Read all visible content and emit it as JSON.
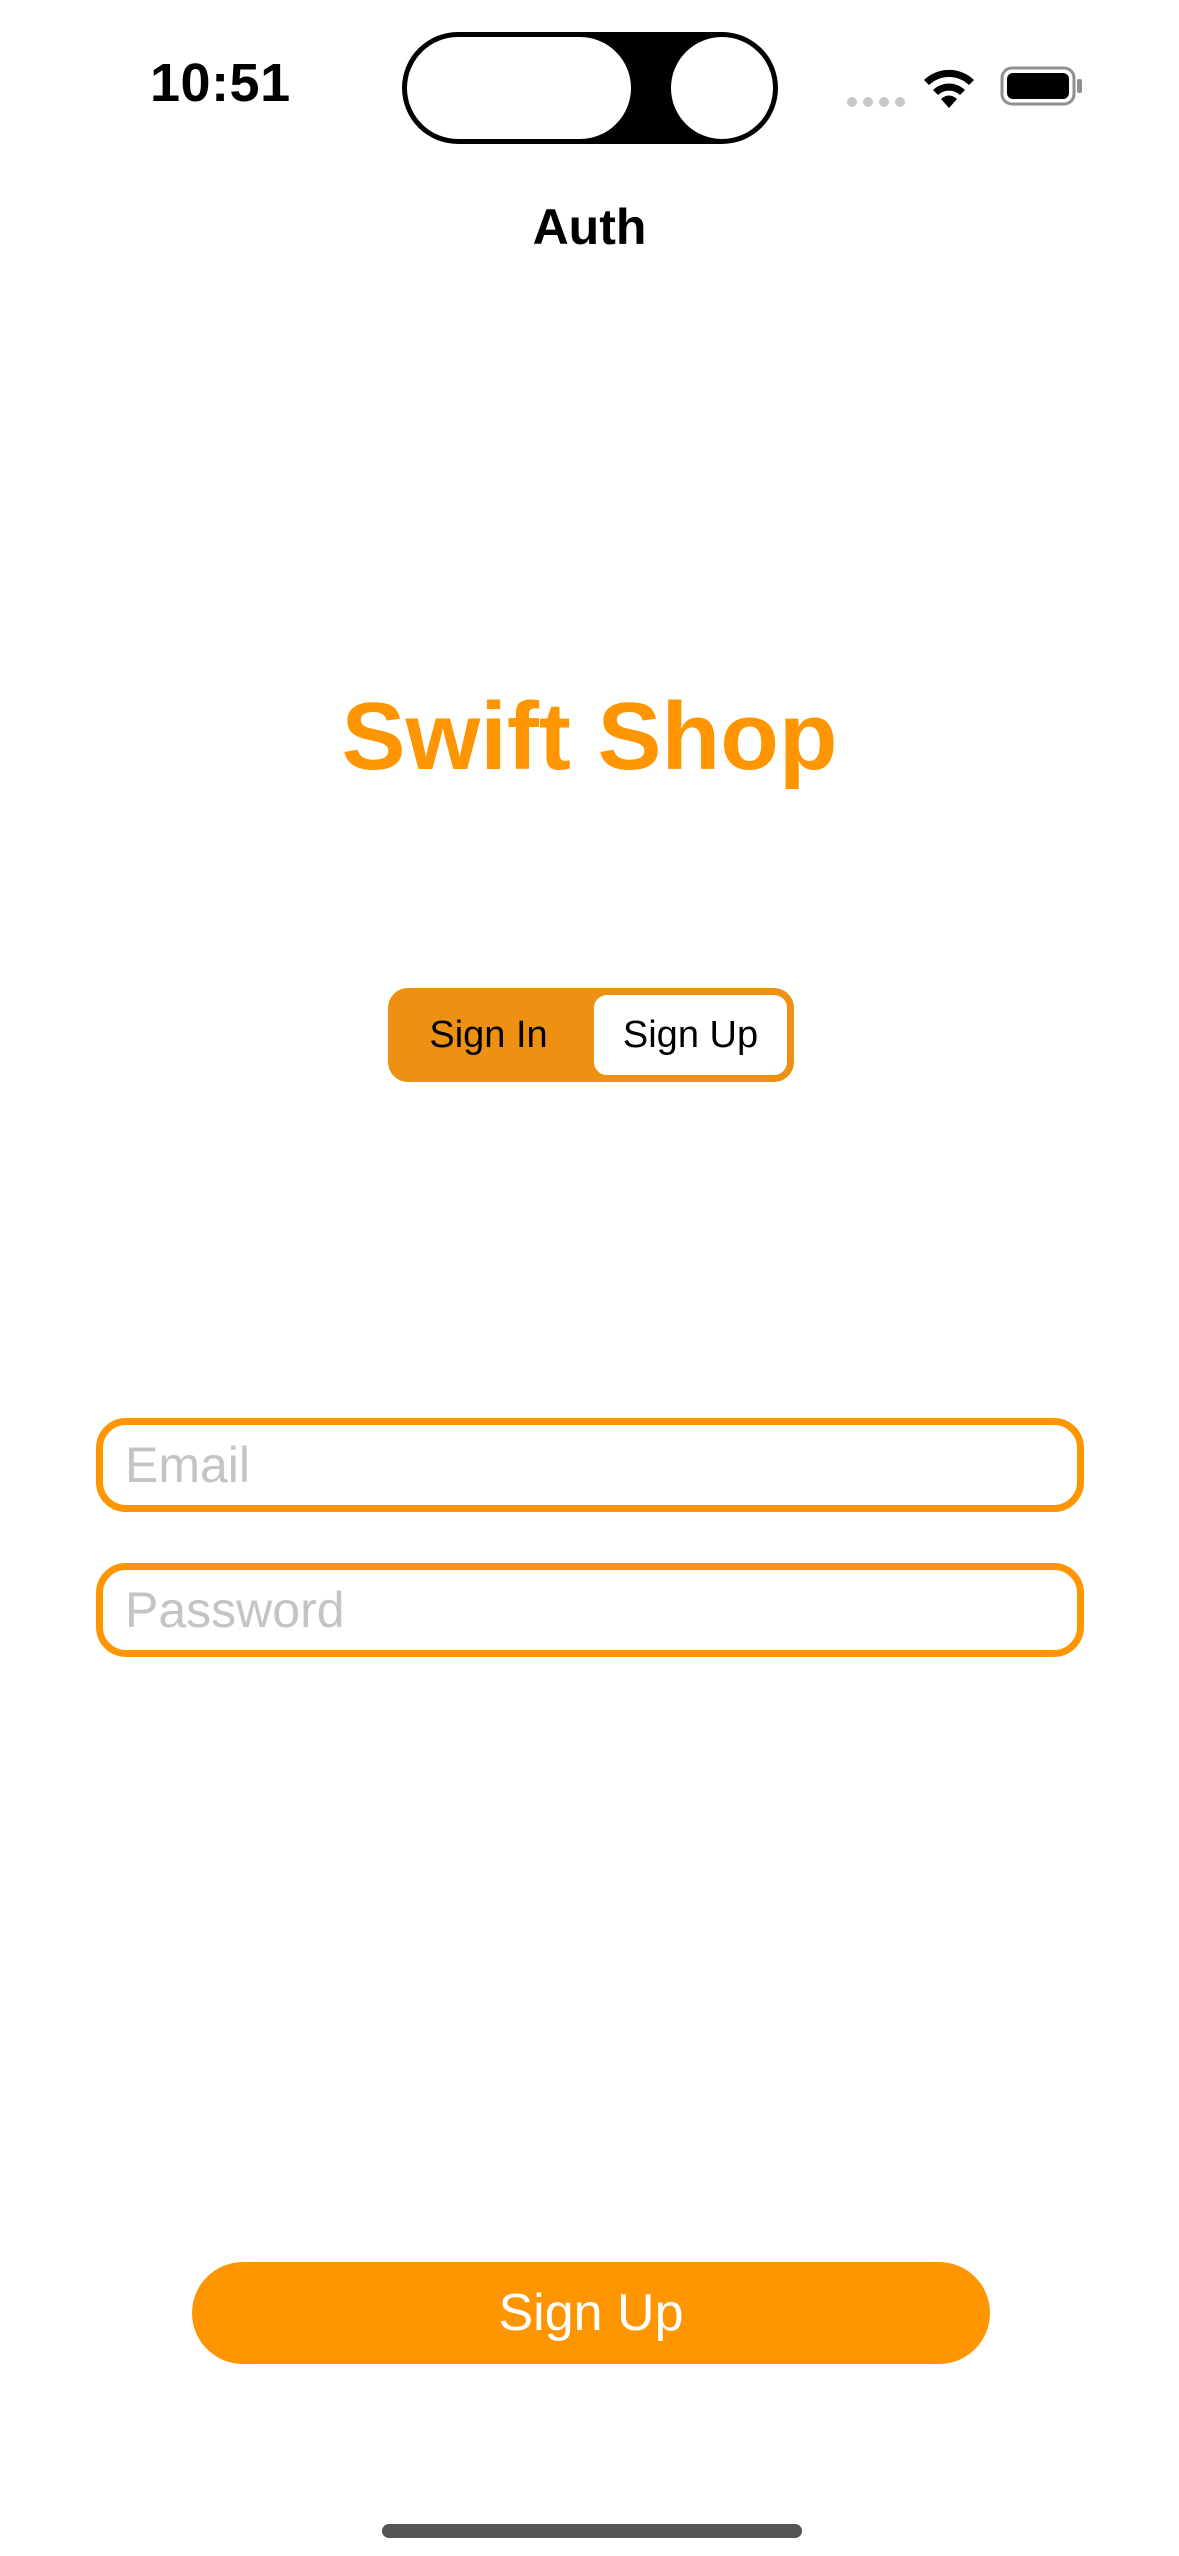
{
  "status_bar": {
    "time": "10:51",
    "wifi_icon": "wifi-icon",
    "battery_icon": "battery-icon",
    "signal_icon": "cellular-dots-icon"
  },
  "nav": {
    "title": "Auth"
  },
  "app": {
    "title": "Swift Shop",
    "accent_color": "#FF9500"
  },
  "auth_mode": {
    "options": [
      "Sign In",
      "Sign Up"
    ],
    "selected": "Sign Up"
  },
  "form": {
    "email": {
      "value": "",
      "placeholder": "Email"
    },
    "password": {
      "value": "",
      "placeholder": "Password"
    }
  },
  "actions": {
    "submit_label": "Sign Up"
  }
}
